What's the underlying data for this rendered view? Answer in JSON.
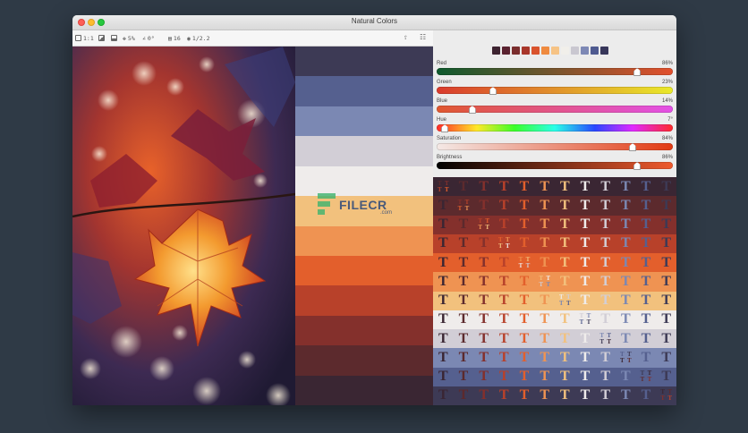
{
  "window": {
    "title": "Natural Colors"
  },
  "toolbar": {
    "zoom": "1:1",
    "steps": "5%",
    "angle": "0°",
    "colors": "16",
    "ratio": "1/2.2"
  },
  "watermark": {
    "text": "FILECR",
    "sub": ".com"
  },
  "palette": {
    "strip": [
      "#3d3a55",
      "#55608f",
      "#7b88b3",
      "#d2ced6",
      "#efeceb",
      "#f2c17d",
      "#ef9352",
      "#e35f2c",
      "#b8412a",
      "#84302c",
      "#5c2a2d",
      "#3a2633"
    ],
    "swatches": [
      "#3d2330",
      "#5a2230",
      "#7a2d2d",
      "#a8362a",
      "#d9532d",
      "#ef8a3f",
      "#f6c385",
      "#f1efea",
      "#c9c7d0",
      "#7d88b5",
      "#4e5a90",
      "#37365a"
    ]
  },
  "sliders": [
    {
      "label": "Red",
      "value": "86%",
      "level": 0.86,
      "gradient": "linear-gradient(90deg,#0e5a2e,#e2502d)"
    },
    {
      "label": "Green",
      "value": "23%",
      "level": 0.23,
      "gradient": "linear-gradient(90deg,#d93a2d,#e9e92a)"
    },
    {
      "label": "Blue",
      "value": "14%",
      "level": 0.14,
      "gradient": "linear-gradient(90deg,#e0582f,#e351e6)"
    },
    {
      "label": "Hue",
      "value": "7°",
      "level": 0.02,
      "gradient": "linear-gradient(90deg,#ff2a2a,#ffe82a 17%,#3bff2a 33%,#2affe8 50%,#2a47ff 67%,#e02aff 83%,#ff2a2a)"
    },
    {
      "label": "Saturation",
      "value": "84%",
      "level": 0.84,
      "gradient": "linear-gradient(90deg,#f4e9e6,#e23a12)"
    },
    {
      "label": "Brightness",
      "value": "86%",
      "level": 0.86,
      "gradient": "linear-gradient(90deg,#000000,#ef5a2d)"
    }
  ],
  "grid": {
    "glyph": "T"
  }
}
